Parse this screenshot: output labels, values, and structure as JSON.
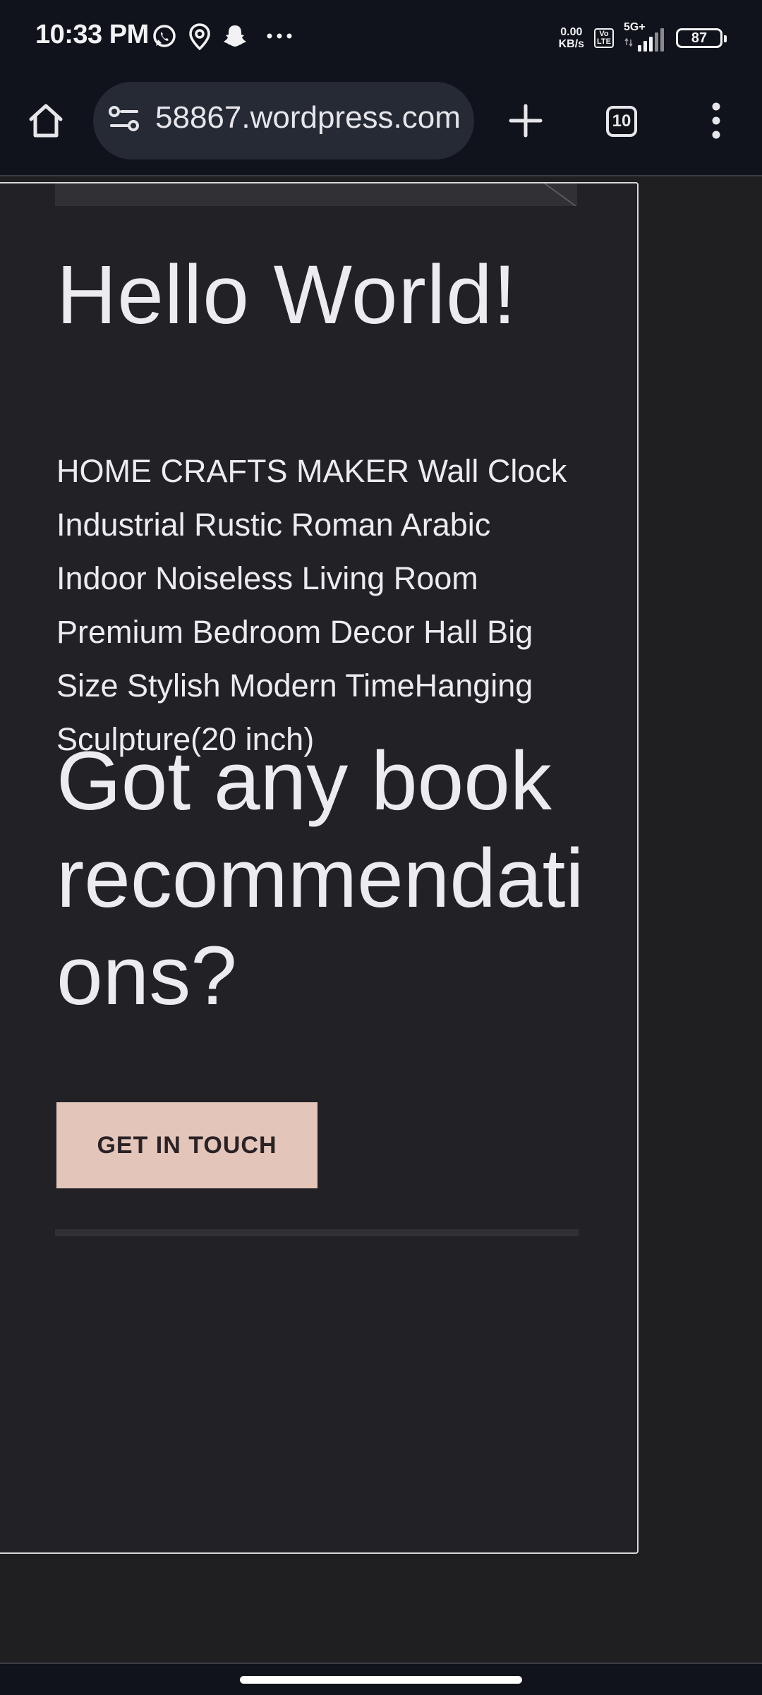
{
  "status_bar": {
    "time": "10:33 PM",
    "icons": [
      "whatsapp-icon",
      "location-icon",
      "snapchat-icon",
      "more-dots-icon"
    ],
    "net_speed_value": "0.00",
    "net_speed_unit": "KB/s",
    "volte_top": "Vo",
    "volte_bottom": "LTE",
    "network_type": "5G+",
    "battery_level": "87"
  },
  "browser": {
    "url": "58867.wordpress.com",
    "tab_count": "10"
  },
  "page": {
    "heading": "Hello World!",
    "product_text": "HOME CRAFTS MAKER Wall Clock Industrial Rustic Roman Arabic Indoor Noiseless Living Room Premium Bedroom Decor Hall Big Size Stylish Modern TimeHanging Sculpture(20 inch)",
    "question": "Got any book recommendations?",
    "cta_label": "GET IN TOUCH"
  },
  "colors": {
    "background": "#1f1f21",
    "card": "#212126",
    "cta": "#e3c5b9",
    "text": "#ececf0",
    "chrome": "#10131b"
  }
}
